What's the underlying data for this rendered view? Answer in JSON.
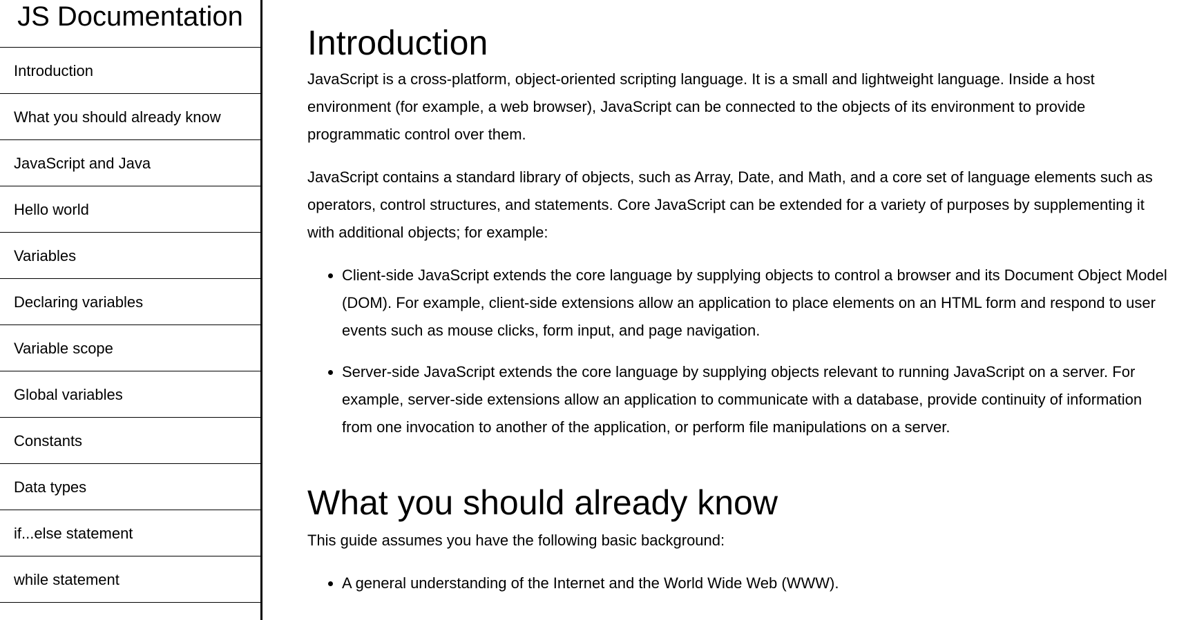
{
  "sidebar": {
    "title": "JS Documentation",
    "items": [
      {
        "label": "Introduction"
      },
      {
        "label": "What you should already know"
      },
      {
        "label": "JavaScript and Java"
      },
      {
        "label": "Hello world"
      },
      {
        "label": "Variables"
      },
      {
        "label": "Declaring variables"
      },
      {
        "label": "Variable scope"
      },
      {
        "label": "Global variables"
      },
      {
        "label": "Constants"
      },
      {
        "label": "Data types"
      },
      {
        "label": "if...else statement"
      },
      {
        "label": "while statement"
      }
    ]
  },
  "main": {
    "sections": [
      {
        "title": "Introduction",
        "paragraphs": [
          "JavaScript is a cross-platform, object-oriented scripting language. It is a small and lightweight language. Inside a host environment (for example, a web browser), JavaScript can be connected to the objects of its environment to provide programmatic control over them.",
          "JavaScript contains a standard library of objects, such as Array, Date, and Math, and a core set of language elements such as operators, control structures, and statements. Core JavaScript can be extended for a variety of purposes by supplementing it with additional objects; for example:"
        ],
        "bullets": [
          "Client-side JavaScript extends the core language by supplying objects to control a browser and its Document Object Model (DOM). For example, client-side extensions allow an application to place elements on an HTML form and respond to user events such as mouse clicks, form input, and page navigation.",
          "Server-side JavaScript extends the core language by supplying objects relevant to running JavaScript on a server. For example, server-side extensions allow an application to communicate with a database, provide continuity of information from one invocation to another of the application, or perform file manipulations on a server."
        ]
      },
      {
        "title": "What you should already know",
        "paragraphs": [
          "This guide assumes you have the following basic background:"
        ],
        "bullets": [
          "A general understanding of the Internet and the World Wide Web (WWW)."
        ]
      }
    ]
  }
}
